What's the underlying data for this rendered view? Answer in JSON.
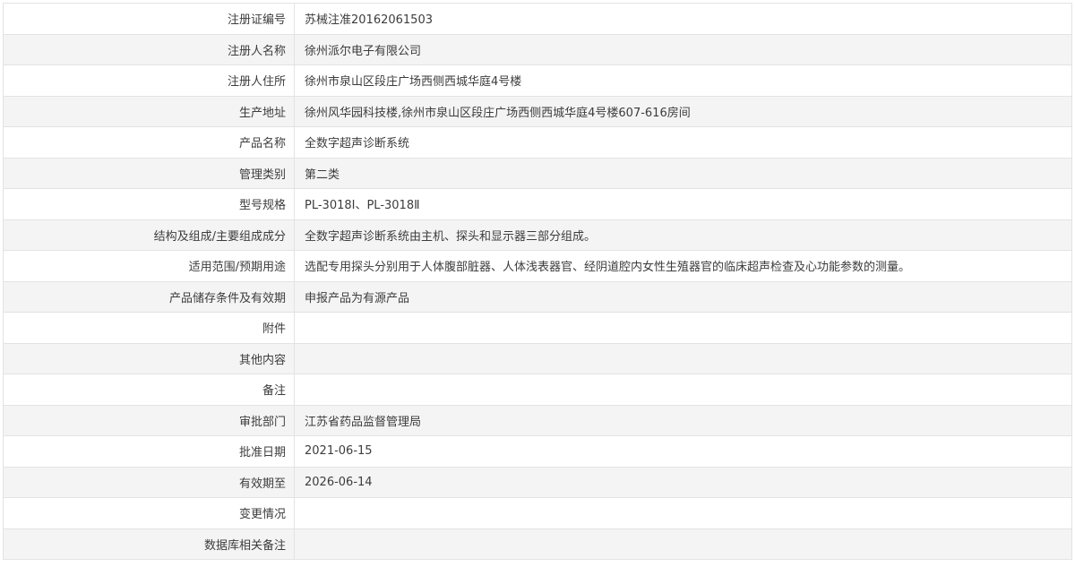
{
  "rows": [
    {
      "label": "注册证编号",
      "value": "苏械注准20162061503"
    },
    {
      "label": "注册人名称",
      "value": "徐州派尔电子有限公司"
    },
    {
      "label": "注册人住所",
      "value": "徐州市泉山区段庄广场西侧西城华庭4号楼"
    },
    {
      "label": "生产地址",
      "value": "徐州风华园科技楼,徐州市泉山区段庄广场西侧西城华庭4号楼607-616房间"
    },
    {
      "label": "产品名称",
      "value": "全数字超声诊断系统"
    },
    {
      "label": "管理类别",
      "value": "第二类"
    },
    {
      "label": "型号规格",
      "value": "PL-3018Ⅰ、PL-3018Ⅱ"
    },
    {
      "label": "结构及组成/主要组成成分",
      "value": "全数字超声诊断系统由主机、探头和显示器三部分组成。"
    },
    {
      "label": "适用范围/预期用途",
      "value": "选配专用探头分别用于人体腹部脏器、人体浅表器官、经阴道腔内女性生殖器官的临床超声检查及心功能参数的测量。"
    },
    {
      "label": "产品储存条件及有效期",
      "value": "申报产品为有源产品"
    },
    {
      "label": "附件",
      "value": ""
    },
    {
      "label": "其他内容",
      "value": ""
    },
    {
      "label": "备注",
      "value": ""
    },
    {
      "label": "审批部门",
      "value": "江苏省药品监督管理局"
    },
    {
      "label": "批准日期",
      "value": "2021-06-15"
    },
    {
      "label": "有效期至",
      "value": "2026-06-14"
    },
    {
      "label": "变更情况",
      "value": ""
    },
    {
      "label": "数据库相关备注",
      "value": ""
    }
  ]
}
